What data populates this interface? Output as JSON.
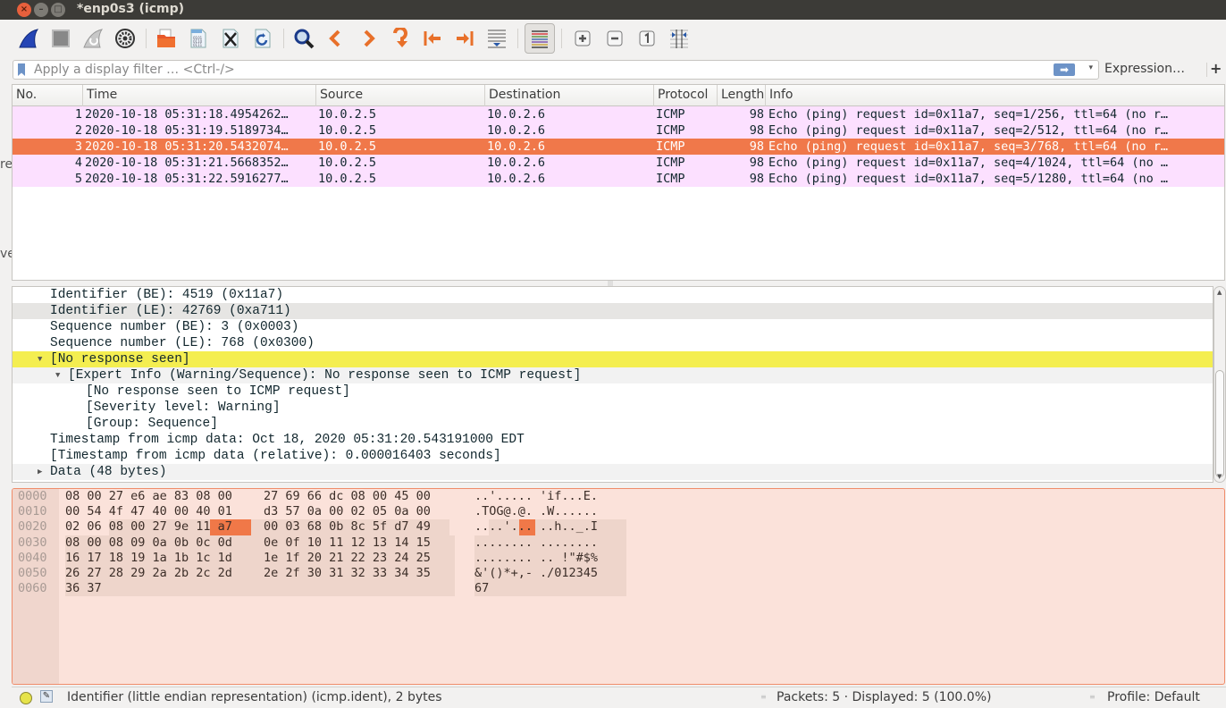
{
  "window": {
    "title": "*enp0s3 (icmp)",
    "close_glyph": "×",
    "minimize_glyph": "–",
    "maximize_glyph": "□"
  },
  "left_fragments": [
    "re",
    "ve"
  ],
  "toolbar": {
    "buttons": [
      {
        "name": "start-capture",
        "icon": "shark-fin-icon"
      },
      {
        "name": "stop-capture",
        "icon": "stop-square-icon"
      },
      {
        "name": "restart-capture",
        "icon": "restart-fin-icon"
      },
      {
        "name": "capture-options",
        "icon": "gear-icon"
      },
      {
        "name": "open-file",
        "icon": "folder-icon"
      },
      {
        "name": "save-file",
        "icon": "binary-file-icon"
      },
      {
        "name": "close-file",
        "icon": "close-file-icon"
      },
      {
        "name": "reload-file",
        "icon": "reload-file-icon"
      },
      {
        "name": "find-packet",
        "icon": "magnifier-icon"
      },
      {
        "name": "go-back",
        "icon": "arrow-left-icon"
      },
      {
        "name": "go-forward",
        "icon": "arrow-right-icon"
      },
      {
        "name": "go-to-packet",
        "icon": "jump-arrow-icon"
      },
      {
        "name": "go-first",
        "icon": "first-packet-icon"
      },
      {
        "name": "go-last",
        "icon": "last-packet-icon"
      },
      {
        "name": "auto-scroll",
        "icon": "autoscroll-icon"
      },
      {
        "name": "colorize",
        "icon": "colorize-lines-icon"
      },
      {
        "name": "zoom-in",
        "icon": "zoom-in-icon"
      },
      {
        "name": "zoom-out",
        "icon": "zoom-out-icon"
      },
      {
        "name": "normal-size",
        "icon": "normal-size-icon"
      },
      {
        "name": "resize-columns",
        "icon": "resize-columns-icon"
      }
    ]
  },
  "filter": {
    "placeholder": "Apply a display filter … <Ctrl-/>",
    "value": "",
    "apply_glyph": "➡",
    "dropdown_glyph": "▾",
    "expression_label": "Expression…",
    "add_label": "+"
  },
  "packet_list": {
    "columns": [
      "No.",
      "Time",
      "Source",
      "Destination",
      "Protocol",
      "Length",
      "Info"
    ],
    "rows": [
      {
        "no": "1",
        "time": "2020-10-18 05:31:18.4954262…",
        "source": "10.0.2.5",
        "destination": "10.0.2.6",
        "protocol": "ICMP",
        "length": "98",
        "info": "Echo (ping) request  id=0x11a7, seq=1/256, ttl=64 (no r…",
        "selected": false
      },
      {
        "no": "2",
        "time": "2020-10-18 05:31:19.5189734…",
        "source": "10.0.2.5",
        "destination": "10.0.2.6",
        "protocol": "ICMP",
        "length": "98",
        "info": "Echo (ping) request  id=0x11a7, seq=2/512, ttl=64 (no r…",
        "selected": false
      },
      {
        "no": "3",
        "time": "2020-10-18 05:31:20.5432074…",
        "source": "10.0.2.5",
        "destination": "10.0.2.6",
        "protocol": "ICMP",
        "length": "98",
        "info": "Echo (ping) request  id=0x11a7, seq=3/768, ttl=64 (no r…",
        "selected": true
      },
      {
        "no": "4",
        "time": "2020-10-18 05:31:21.5668352…",
        "source": "10.0.2.5",
        "destination": "10.0.2.6",
        "protocol": "ICMP",
        "length": "98",
        "info": "Echo (ping) request  id=0x11a7, seq=4/1024, ttl=64 (no …",
        "selected": false
      },
      {
        "no": "5",
        "time": "2020-10-18 05:31:22.5916277…",
        "source": "10.0.2.5",
        "destination": "10.0.2.6",
        "protocol": "ICMP",
        "length": "98",
        "info": "Echo (ping) request  id=0x11a7, seq=5/1280, ttl=64 (no …",
        "selected": false
      }
    ]
  },
  "details": {
    "rows": [
      {
        "text": "Identifier (BE): 4519 (0x11a7)",
        "level": 0,
        "toggle": "",
        "style": ""
      },
      {
        "text": "Identifier (LE): 42769 (0xa711)",
        "level": 0,
        "toggle": "",
        "style": "hl"
      },
      {
        "text": "Sequence number (BE): 3 (0x0003)",
        "level": 0,
        "toggle": "",
        "style": ""
      },
      {
        "text": "Sequence number (LE): 768 (0x0300)",
        "level": 0,
        "toggle": "",
        "style": ""
      },
      {
        "text": "[No response seen]",
        "level": 0,
        "toggle": "▼",
        "style": "yellow"
      },
      {
        "text": "[Expert Info (Warning/Sequence): No response seen to ICMP request]",
        "level": 1,
        "toggle": "▼",
        "style": "ltgray"
      },
      {
        "text": "[No response seen to ICMP request]",
        "level": 2,
        "toggle": "",
        "style": ""
      },
      {
        "text": "[Severity level: Warning]",
        "level": 2,
        "toggle": "",
        "style": ""
      },
      {
        "text": "[Group: Sequence]",
        "level": 2,
        "toggle": "",
        "style": ""
      },
      {
        "text": "Timestamp from icmp data: Oct 18, 2020 05:31:20.543191000 EDT",
        "level": 0,
        "toggle": "",
        "style": ""
      },
      {
        "text": "[Timestamp from icmp data (relative): 0.000016403 seconds]",
        "level": 0,
        "toggle": "",
        "style": ""
      },
      {
        "text": "Data (48 bytes)",
        "level": 0,
        "toggle": "▶",
        "style": "ltgray"
      }
    ]
  },
  "bytes": {
    "rows": [
      {
        "offset": "0000",
        "hex1": "08 00 27 e6 ae 83 08 00",
        "hex2": "27 69 66 dc 08 00 45 00",
        "ascii1": "..'.....",
        "ascii2": "'if...E."
      },
      {
        "offset": "0010",
        "hex1": "00 54 4f 47 40 00 40 01",
        "hex2": "d3 57 0a 00 02 05 0a 00",
        "ascii1": ".TOG@.@.",
        "ascii2": ".W......"
      },
      {
        "offset": "0020",
        "hex1": "02 06 08 00 27 9e 11 a7",
        "hex2": "00 03 68 0b 8c 5f d7 49",
        "ascii1": "....'...",
        "ascii2": "..h.._.I"
      },
      {
        "offset": "0030",
        "hex1": "08 00 08 09 0a 0b 0c 0d",
        "hex2": "0e 0f 10 11 12 13 14 15",
        "ascii1": "........",
        "ascii2": "........"
      },
      {
        "offset": "0040",
        "hex1": "16 17 18 19 1a 1b 1c 1d",
        "hex2": "1e 1f 20 21 22 23 24 25",
        "ascii1": "........",
        "ascii2": ".. !\"#$%"
      },
      {
        "offset": "0050",
        "hex1": "26 27 28 29 2a 2b 2c 2d",
        "hex2": "2e 2f 30 31 32 33 34 35",
        "ascii1": "&'()*+,-",
        "ascii2": "./012345"
      },
      {
        "offset": "0060",
        "hex1": "36 37",
        "hex2": "",
        "ascii1": "67",
        "ascii2": ""
      }
    ],
    "selected_hex": "11 a7",
    "selected_ascii": ".."
  },
  "statusbar": {
    "message": "Identifier (little endian representation) (icmp.ident), 2 bytes",
    "packets": "Packets: 5 · Displayed: 5 (100.0%)",
    "profile": "Profile: Default",
    "edit_glyph": "✎"
  },
  "colors": {
    "row_bg": "#fce0ff",
    "selected_row": "#f0784a",
    "warning_yellow": "#f4ee50",
    "bytes_bg": "#fbe2da"
  }
}
